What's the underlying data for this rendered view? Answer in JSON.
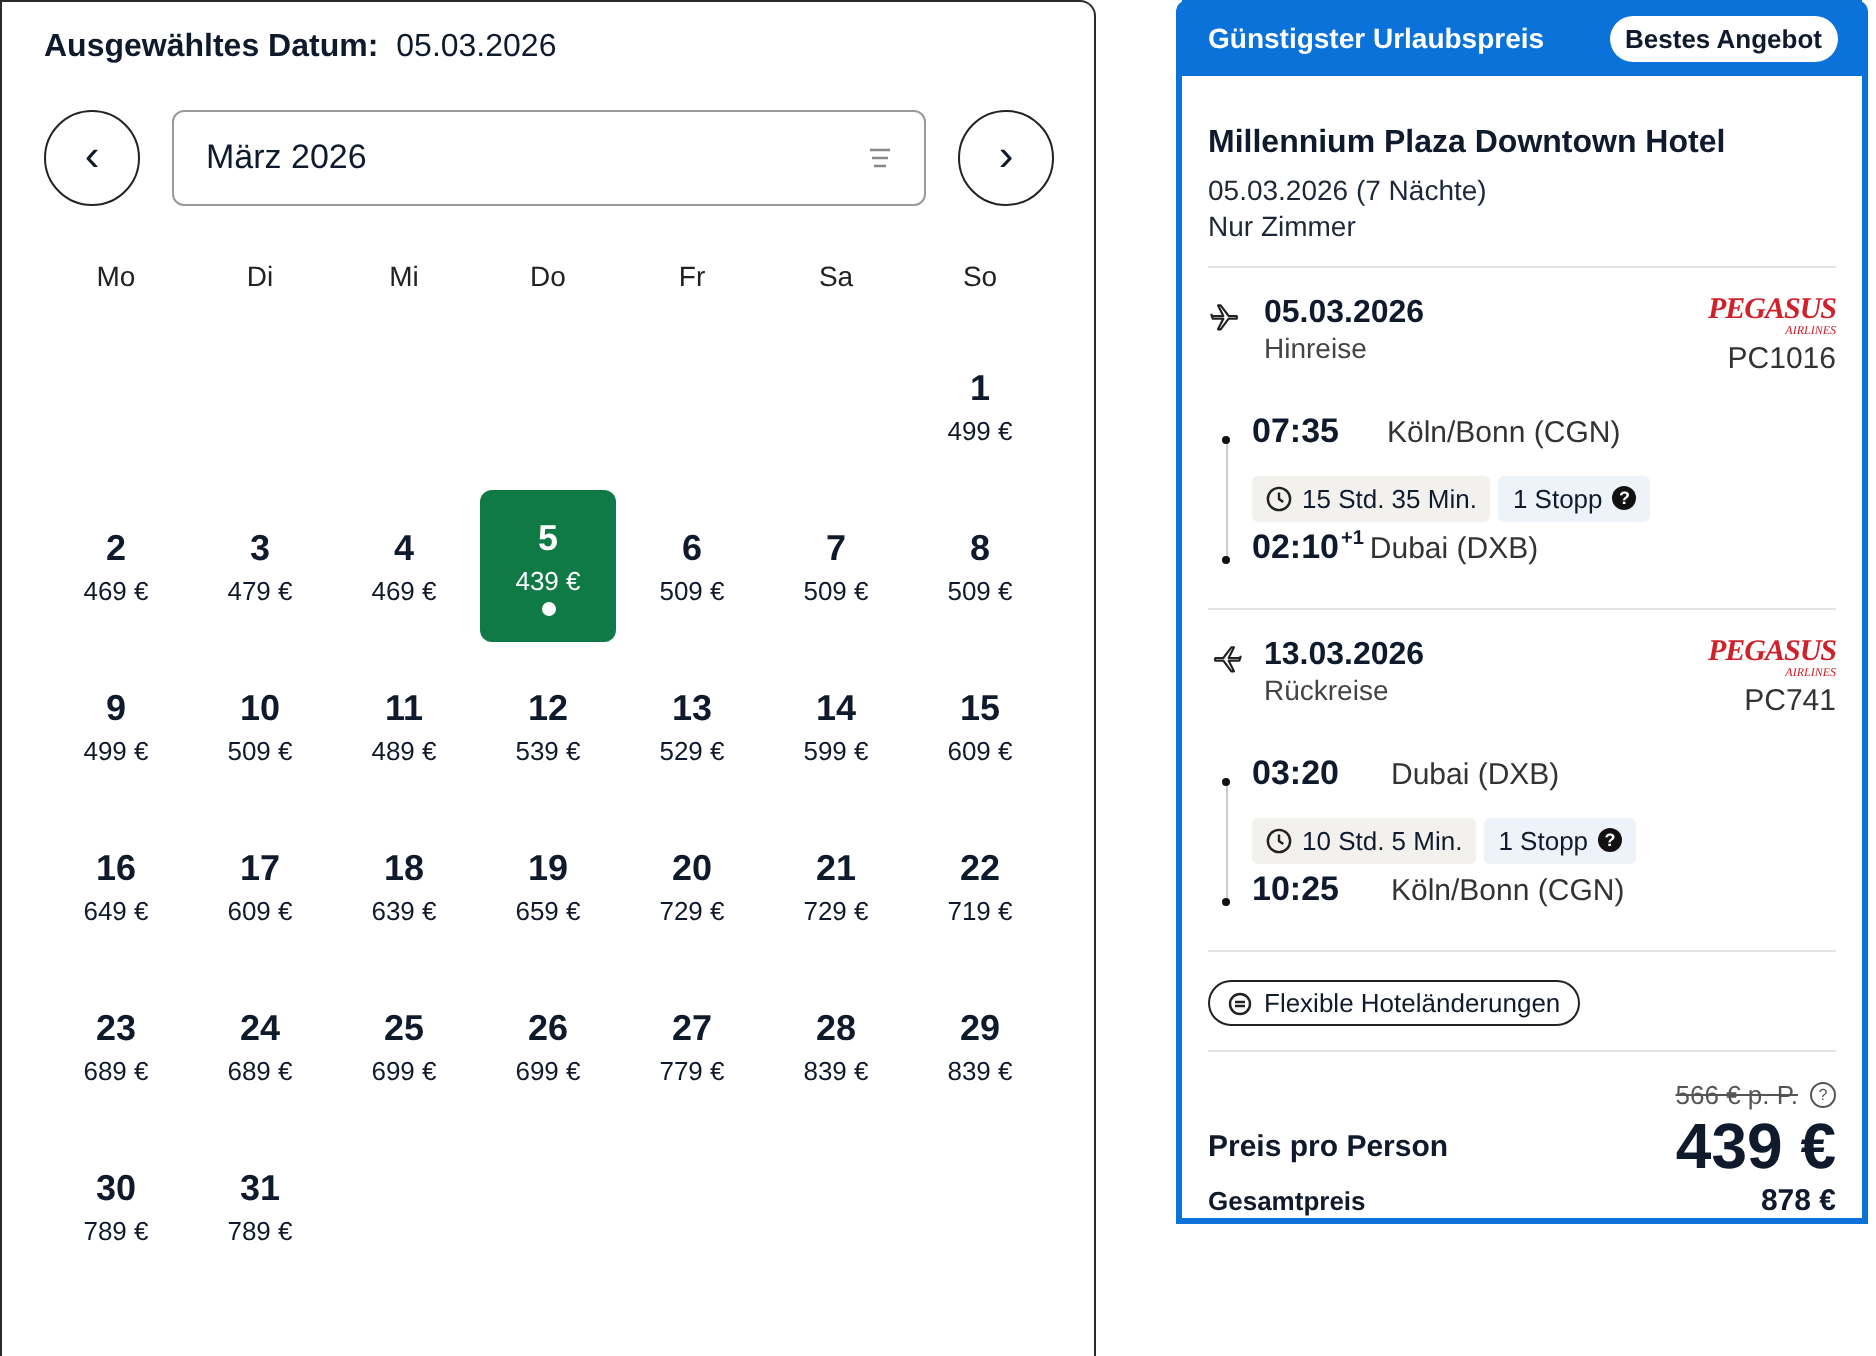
{
  "selected_date": {
    "label": "Ausgewähltes Datum:",
    "value": "05.03.2026"
  },
  "month_picker": {
    "prev": "‹",
    "month": "März 2026",
    "next": "›"
  },
  "weekdays": [
    "Mo",
    "Di",
    "Mi",
    "Do",
    "Fr",
    "Sa",
    "So"
  ],
  "weeks": [
    [
      {
        "kind": "empty"
      },
      {
        "kind": "empty"
      },
      {
        "kind": "empty"
      },
      {
        "kind": "empty"
      },
      {
        "kind": "empty"
      },
      {
        "kind": "empty"
      },
      {
        "kind": "day",
        "day": "1",
        "price": "499 €",
        "selected": false
      }
    ],
    [
      {
        "kind": "day",
        "day": "2",
        "price": "469 €",
        "selected": false
      },
      {
        "kind": "day",
        "day": "3",
        "price": "479 €",
        "selected": false
      },
      {
        "kind": "day",
        "day": "4",
        "price": "469 €",
        "selected": false
      },
      {
        "kind": "day",
        "day": "5",
        "price": "439 €",
        "selected": true
      },
      {
        "kind": "day",
        "day": "6",
        "price": "509 €",
        "selected": false
      },
      {
        "kind": "day",
        "day": "7",
        "price": "509 €",
        "selected": false
      },
      {
        "kind": "day",
        "day": "8",
        "price": "509 €",
        "selected": false
      }
    ],
    [
      {
        "kind": "day",
        "day": "9",
        "price": "499 €",
        "selected": false
      },
      {
        "kind": "day",
        "day": "10",
        "price": "509 €",
        "selected": false
      },
      {
        "kind": "day",
        "day": "11",
        "price": "489 €",
        "selected": false
      },
      {
        "kind": "day",
        "day": "12",
        "price": "539 €",
        "selected": false
      },
      {
        "kind": "day",
        "day": "13",
        "price": "529 €",
        "selected": false
      },
      {
        "kind": "day",
        "day": "14",
        "price": "599 €",
        "selected": false
      },
      {
        "kind": "day",
        "day": "15",
        "price": "609 €",
        "selected": false
      }
    ],
    [
      {
        "kind": "day",
        "day": "16",
        "price": "649 €",
        "selected": false
      },
      {
        "kind": "day",
        "day": "17",
        "price": "609 €",
        "selected": false
      },
      {
        "kind": "day",
        "day": "18",
        "price": "639 €",
        "selected": false
      },
      {
        "kind": "day",
        "day": "19",
        "price": "659 €",
        "selected": false
      },
      {
        "kind": "day",
        "day": "20",
        "price": "729 €",
        "selected": false
      },
      {
        "kind": "day",
        "day": "21",
        "price": "729 €",
        "selected": false
      },
      {
        "kind": "day",
        "day": "22",
        "price": "719 €",
        "selected": false
      }
    ],
    [
      {
        "kind": "day",
        "day": "23",
        "price": "689 €",
        "selected": false
      },
      {
        "kind": "day",
        "day": "24",
        "price": "689 €",
        "selected": false
      },
      {
        "kind": "day",
        "day": "25",
        "price": "699 €",
        "selected": false
      },
      {
        "kind": "day",
        "day": "26",
        "price": "699 €",
        "selected": false
      },
      {
        "kind": "day",
        "day": "27",
        "price": "779 €",
        "selected": false
      },
      {
        "kind": "day",
        "day": "28",
        "price": "839 €",
        "selected": false
      },
      {
        "kind": "day",
        "day": "29",
        "price": "839 €",
        "selected": false
      }
    ],
    [
      {
        "kind": "day",
        "day": "30",
        "price": "789 €",
        "selected": false
      },
      {
        "kind": "day",
        "day": "31",
        "price": "789 €",
        "selected": false
      },
      {
        "kind": "empty"
      },
      {
        "kind": "empty"
      },
      {
        "kind": "empty"
      },
      {
        "kind": "empty"
      },
      {
        "kind": "empty"
      }
    ]
  ],
  "offer": {
    "title": "Günstigster Urlaubspreis",
    "badge": "Bestes Angebot",
    "hotel": "Millennium Plaza Downtown Hotel",
    "stay": "05.03.2026 (7 Nächte)",
    "board": "Nur Zimmer",
    "flights": [
      {
        "kind": "outbound",
        "date": "05.03.2026",
        "label": "Hinreise",
        "airline_logo": "PEGASUS",
        "airline_logo_sub": "AIRLINES",
        "flight_no": "PC1016",
        "depart_time": "07:35",
        "depart_place": "Köln/Bonn (CGN)",
        "duration": "15 Std. 35 Min.",
        "stops": "1 Stopp",
        "stops_help": "?",
        "arrive_time": "02:10",
        "arrive_offset": "+1",
        "arrive_place": "Dubai (DXB)"
      },
      {
        "kind": "return",
        "date": "13.03.2026",
        "label": "Rückreise",
        "airline_logo": "PEGASUS",
        "airline_logo_sub": "AIRLINES",
        "flight_no": "PC741",
        "depart_time": "03:20",
        "depart_place": "Dubai (DXB)",
        "duration": "10 Std. 5 Min.",
        "stops": "1 Stopp",
        "stops_help": "?",
        "arrive_time": "10:25",
        "arrive_place": "Köln/Bonn (CGN)"
      }
    ],
    "feature": "Flexible Hoteländerungen",
    "old_price": "566 € p. P.",
    "old_price_help": "?",
    "price_label": "Preis pro Person",
    "price": "439 €",
    "total_label": "Gesamtpreis",
    "total": "878 €"
  }
}
